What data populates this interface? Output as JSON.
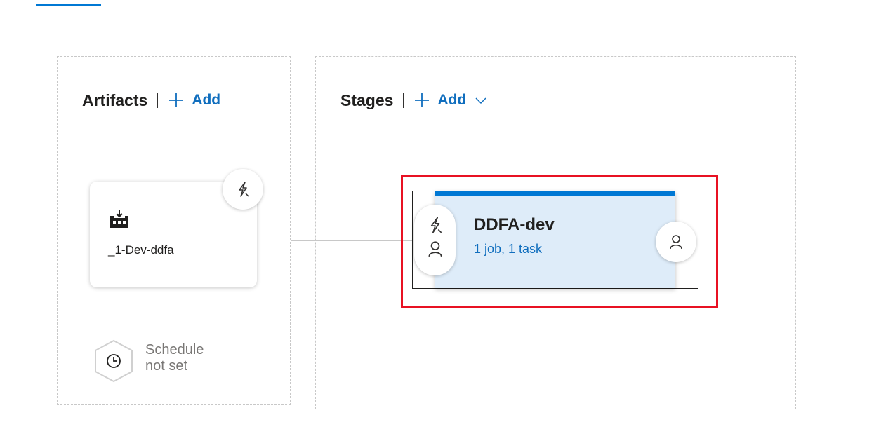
{
  "artifacts": {
    "title": "Artifacts",
    "add_label": "Add",
    "items": [
      {
        "name": "_1-Dev-ddfa",
        "icon": "build-artifact-icon",
        "trigger_icon": "lightning-icon"
      }
    ],
    "schedule": {
      "line1": "Schedule",
      "line2": "not set",
      "icon": "clock-icon"
    }
  },
  "stages": {
    "title": "Stages",
    "add_label": "Add",
    "items": [
      {
        "name": "DDFA-dev",
        "summary": "1 job, 1 task",
        "pre_icons": [
          "lightning-icon",
          "person-icon"
        ],
        "post_icon": "person-icon"
      }
    ]
  },
  "colors": {
    "accent": "#0078d4",
    "link": "#106ebe",
    "stage_bg": "#deecf9",
    "highlight": "#e81123",
    "muted_text": "#797775"
  }
}
